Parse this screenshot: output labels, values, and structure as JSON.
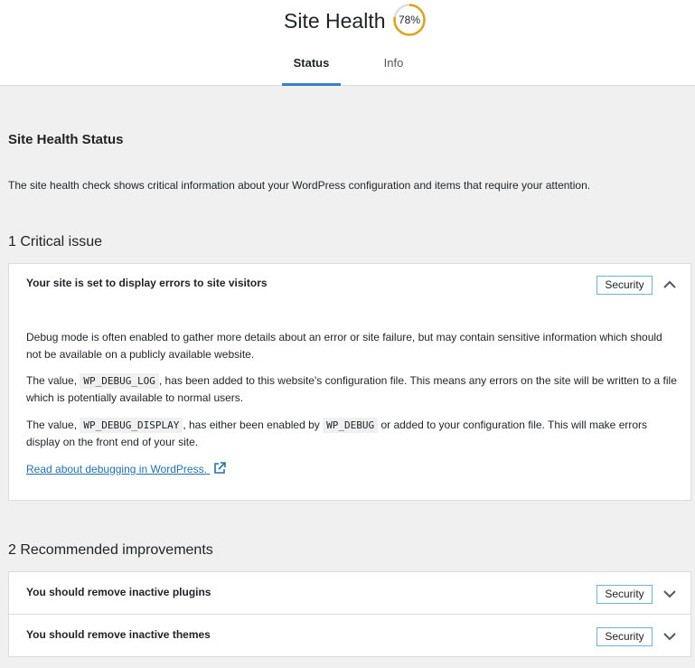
{
  "header": {
    "title": "Site Health",
    "score": "78%",
    "score_value": 78,
    "score_color": "#dba617",
    "tabs": [
      {
        "label": "Status",
        "active": true
      },
      {
        "label": "Info",
        "active": false
      }
    ]
  },
  "main": {
    "section_title": "Site Health Status",
    "description": "The site health check shows critical information about your WordPress configuration and items that require your attention.",
    "critical": {
      "group_title": "1 Critical issue",
      "issue": {
        "title": "Your site is set to display errors to site visitors",
        "badge": "Security",
        "expanded": true,
        "p1": "Debug mode is often enabled to gather more details about an error or site failure, but may contain sensitive information which should not be available on a publicly available website.",
        "p2_a": "The value, ",
        "p2_code": "WP_DEBUG_LOG",
        "p2_b": ", has been added to this website's configuration file. This means any errors on the site will be written to a file which is potentially available to normal users.",
        "p3_a": "The value, ",
        "p3_code1": "WP_DEBUG_DISPLAY",
        "p3_b": ", has either been enabled by ",
        "p3_code2": "WP_DEBUG",
        "p3_c": " or added to your configuration file. This will make errors display on the front end of your site.",
        "link": "Read about debugging in WordPress."
      }
    },
    "recommended": {
      "group_title": "2 Recommended improvements",
      "items": [
        {
          "title": "You should remove inactive plugins",
          "badge": "Security",
          "expanded": false
        },
        {
          "title": "You should remove inactive themes",
          "badge": "Security",
          "expanded": false
        }
      ]
    }
  },
  "icons": {
    "chevron_up": "chevron-up-icon",
    "chevron_down": "chevron-down-icon",
    "external_link": "external-link-icon"
  }
}
